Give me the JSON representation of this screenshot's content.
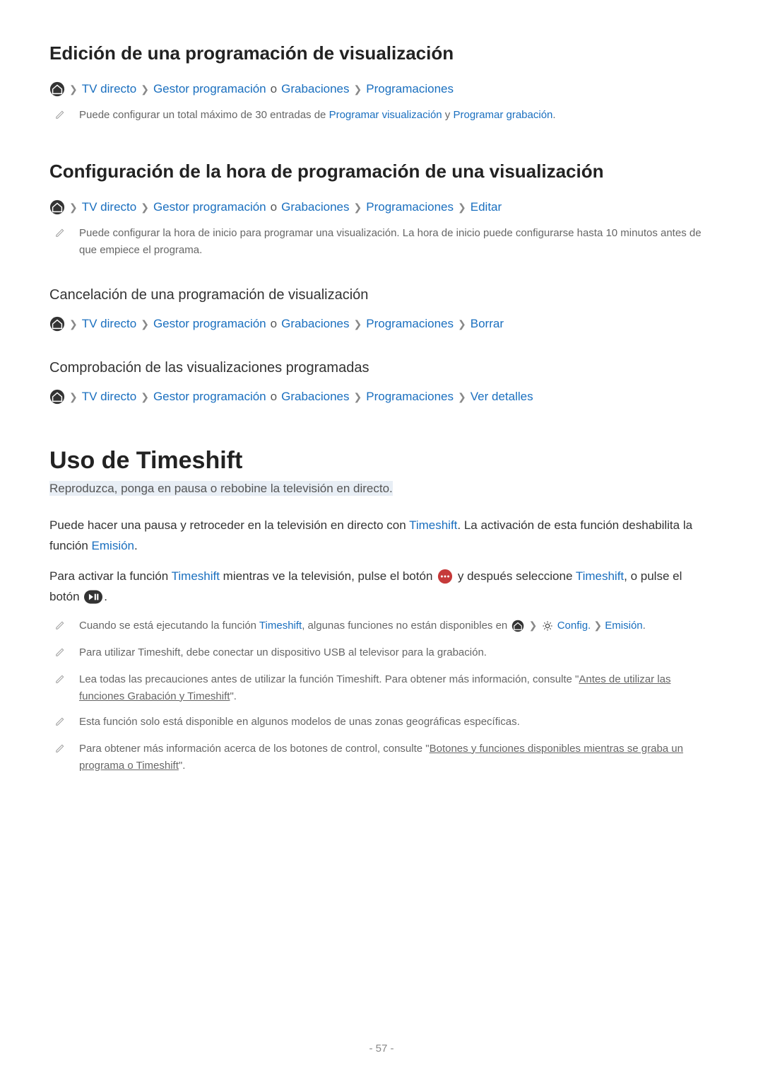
{
  "sections": {
    "s1": {
      "heading": "Edición de una programación de visualización",
      "crumbs": [
        "TV directo",
        "Gestor programación",
        "o",
        "Grabaciones",
        "Programaciones"
      ],
      "note": {
        "pre": "Puede configurar un total máximo de 30 entradas de ",
        "link1": "Programar visualización",
        "mid": " y ",
        "link2": "Programar grabación",
        "post": "."
      }
    },
    "s2": {
      "heading": "Configuración de la hora de programación de una visualización",
      "crumbs": [
        "TV directo",
        "Gestor programación",
        "o",
        "Grabaciones",
        "Programaciones",
        "Editar"
      ],
      "note": "Puede configurar la hora de inicio para programar una visualización. La hora de inicio puede configurarse hasta 10 minutos antes de que empiece el programa."
    },
    "s3": {
      "heading": "Cancelación de una programación de visualización",
      "crumbs": [
        "TV directo",
        "Gestor programación",
        "o",
        "Grabaciones",
        "Programaciones",
        "Borrar"
      ]
    },
    "s4": {
      "heading": "Comprobación de las visualizaciones programadas",
      "crumbs": [
        "TV directo",
        "Gestor programación",
        "o",
        "Grabaciones",
        "Programaciones",
        "Ver detalles"
      ]
    },
    "timeshift": {
      "heading": "Uso de Timeshift",
      "subtitle": "Reproduzca, ponga en pausa o rebobine la televisión en directo.",
      "p1": {
        "pre": "Puede hacer una pausa y retroceder en la televisión en directo con ",
        "link1": "Timeshift",
        "mid": ". La activación de esta función deshabilita la función ",
        "link2": "Emisión",
        "post": "."
      },
      "p2": {
        "pre": "Para activar la función ",
        "link1": "Timeshift",
        "mid": " mientras ve la televisión, pulse el botón ",
        "after_dots": " y después seleccione ",
        "link2": "Timeshift",
        "tail1": ", o pulse el botón ",
        "tail2": "."
      },
      "notes": {
        "n1": {
          "pre": "Cuando se está ejecutando la función ",
          "link1": "Timeshift",
          "mid": ", algunas funciones no están disponibles en ",
          "config": "Config.",
          "emision": "Emisión",
          "post": "."
        },
        "n2": "Para utilizar Timeshift, debe conectar un dispositivo USB al televisor para la grabación.",
        "n3": {
          "pre": "Lea todas las precauciones antes de utilizar la función Timeshift. Para obtener más información, consulte \"",
          "ul": "Antes de utilizar las funciones Grabación y Timeshift",
          "post": "\"."
        },
        "n4": "Esta función solo está disponible en algunos modelos de unas zonas geográficas específicas.",
        "n5": {
          "pre": "Para obtener más información acerca de los botones de control, consulte \"",
          "ul": "Botones y funciones disponibles mientras se graba un programa o Timeshift",
          "post": "\"."
        }
      }
    }
  },
  "page_number": "- 57 -"
}
